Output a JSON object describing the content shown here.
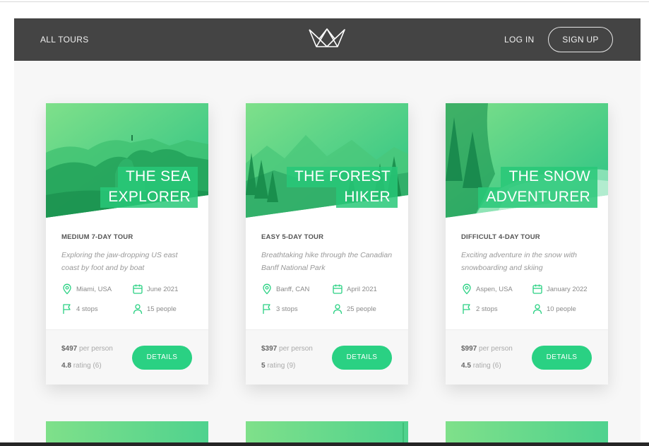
{
  "nav": {
    "all_tours": "ALL TOURS",
    "login": "LOG IN",
    "signup": "SIGN UP",
    "logo_icon": "crown-logo-icon"
  },
  "colors": {
    "header_bg": "#444444",
    "accent": "#2ad183",
    "page_bg": "#f7f7f7"
  },
  "tours": [
    {
      "title_line1": "THE SEA",
      "title_line2": "EXPLORER",
      "tag": "MEDIUM 7-DAY TOUR",
      "description": "Exploring the jaw-dropping US east coast by foot and by boat",
      "location": "Miami, USA",
      "date": "June 2021",
      "stops": "4 stops",
      "people": "15 people",
      "price": "$497",
      "price_suffix": "per person",
      "rating": "4.8",
      "rating_suffix": "rating (6)",
      "button": "DETAILS"
    },
    {
      "title_line1": "THE FOREST",
      "title_line2": "HIKER",
      "tag": "EASY 5-DAY TOUR",
      "description": "Breathtaking hike through the Canadian Banff National Park",
      "location": "Banff, CAN",
      "date": "April 2021",
      "stops": "3 stops",
      "people": "25 people",
      "price": "$397",
      "price_suffix": "per person",
      "rating": "5",
      "rating_suffix": "rating (9)",
      "button": "DETAILS"
    },
    {
      "title_line1": "THE SNOW",
      "title_line2": "ADVENTURER",
      "tag": "DIFFICULT 4-DAY TOUR",
      "description": "Exciting adventure in the snow with snowboarding and skiing",
      "location": "Aspen, USA",
      "date": "January 2022",
      "stops": "2 stops",
      "people": "10 people",
      "price": "$997",
      "price_suffix": "per person",
      "rating": "4.5",
      "rating_suffix": "rating (6)",
      "button": "DETAILS"
    }
  ],
  "icons": {
    "location": "map-pin-icon",
    "date": "calendar-icon",
    "stops": "flag-icon",
    "people": "user-icon"
  }
}
